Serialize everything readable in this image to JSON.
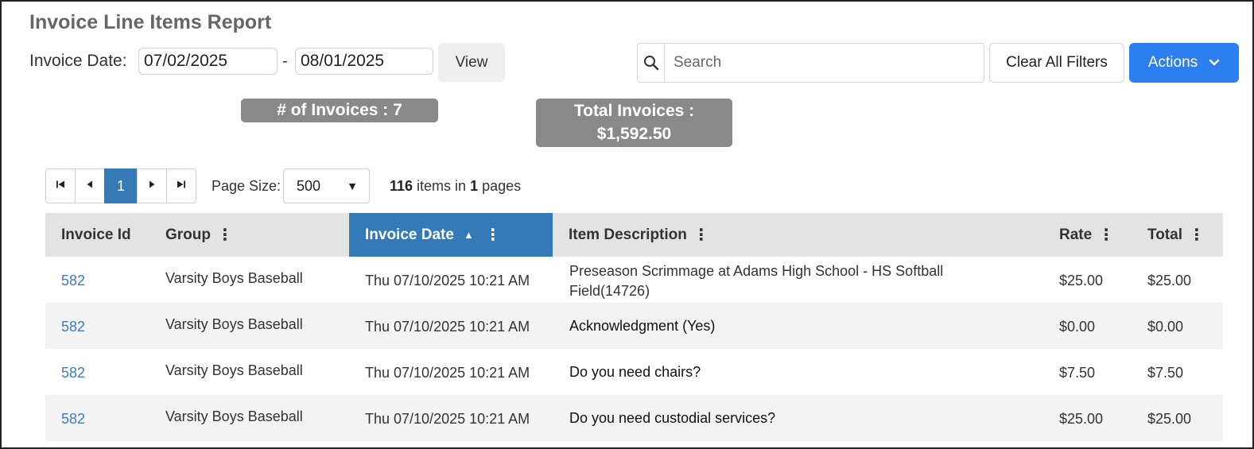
{
  "page": {
    "title": "Invoice Line Items Report"
  },
  "filters": {
    "date_label": "Invoice Date:",
    "date_from": "07/02/2025",
    "date_separator": "-",
    "date_to": "08/01/2025",
    "view_label": "View"
  },
  "toolbar": {
    "search_placeholder": "Search",
    "search_value": "",
    "clear_filters_label": "Clear All Filters",
    "actions_label": "Actions"
  },
  "stats": {
    "invoice_count_text": "# of Invoices : 7",
    "total_label": "Total Invoices :",
    "total_value": "$1,592.50"
  },
  "pager": {
    "current_page": "1",
    "page_size_label": "Page Size:",
    "page_size_value": "500",
    "items_count": "116",
    "items_in_text": " items in ",
    "pages_count": "1",
    "pages_text": " pages"
  },
  "table": {
    "columns": [
      {
        "label": "Invoice Id"
      },
      {
        "label": "Group"
      },
      {
        "label": "Invoice Date"
      },
      {
        "label": "Item Description"
      },
      {
        "label": "Rate"
      },
      {
        "label": "Total"
      }
    ],
    "rows": [
      {
        "invoice_id": "582",
        "group": "Varsity Boys Baseball",
        "invoice_date": "Thu 07/10/2025 10:21 AM",
        "desc_line1": "Preseason Scrimmage at Adams High School - HS Softball",
        "desc_line2": "Field(14726)",
        "rate": "$25.00",
        "total": "$25.00"
      },
      {
        "invoice_id": "582",
        "group": "Varsity Boys Baseball",
        "invoice_date": "Thu 07/10/2025 10:21 AM",
        "description": "Acknowledgment (Yes)",
        "rate": "$0.00",
        "total": "$0.00"
      },
      {
        "invoice_id": "582",
        "group": "Varsity Boys Baseball",
        "invoice_date": "Thu 07/10/2025 10:21 AM",
        "description": "Do you need chairs?",
        "rate": "$7.50",
        "total": "$7.50"
      },
      {
        "invoice_id": "582",
        "group": "Varsity Boys Baseball",
        "invoice_date": "Thu 07/10/2025 10:21 AM",
        "description": "Do you need custodial services?",
        "rate": "$25.00",
        "total": "$25.00"
      }
    ]
  },
  "icons": {
    "search": "search-icon",
    "actions_caret": "chevron-down-icon",
    "first_page": "first-page-icon",
    "prev_page": "prev-page-icon",
    "next_page": "next-page-icon",
    "last_page": "last-page-icon",
    "column_menu": "kebab-menu-icon",
    "sort": "sort-ascending-icon"
  },
  "colors": {
    "accent": "#2d7ff0",
    "selected": "#337ab7",
    "link": "#3e7ac4",
    "badge": "#898989"
  }
}
